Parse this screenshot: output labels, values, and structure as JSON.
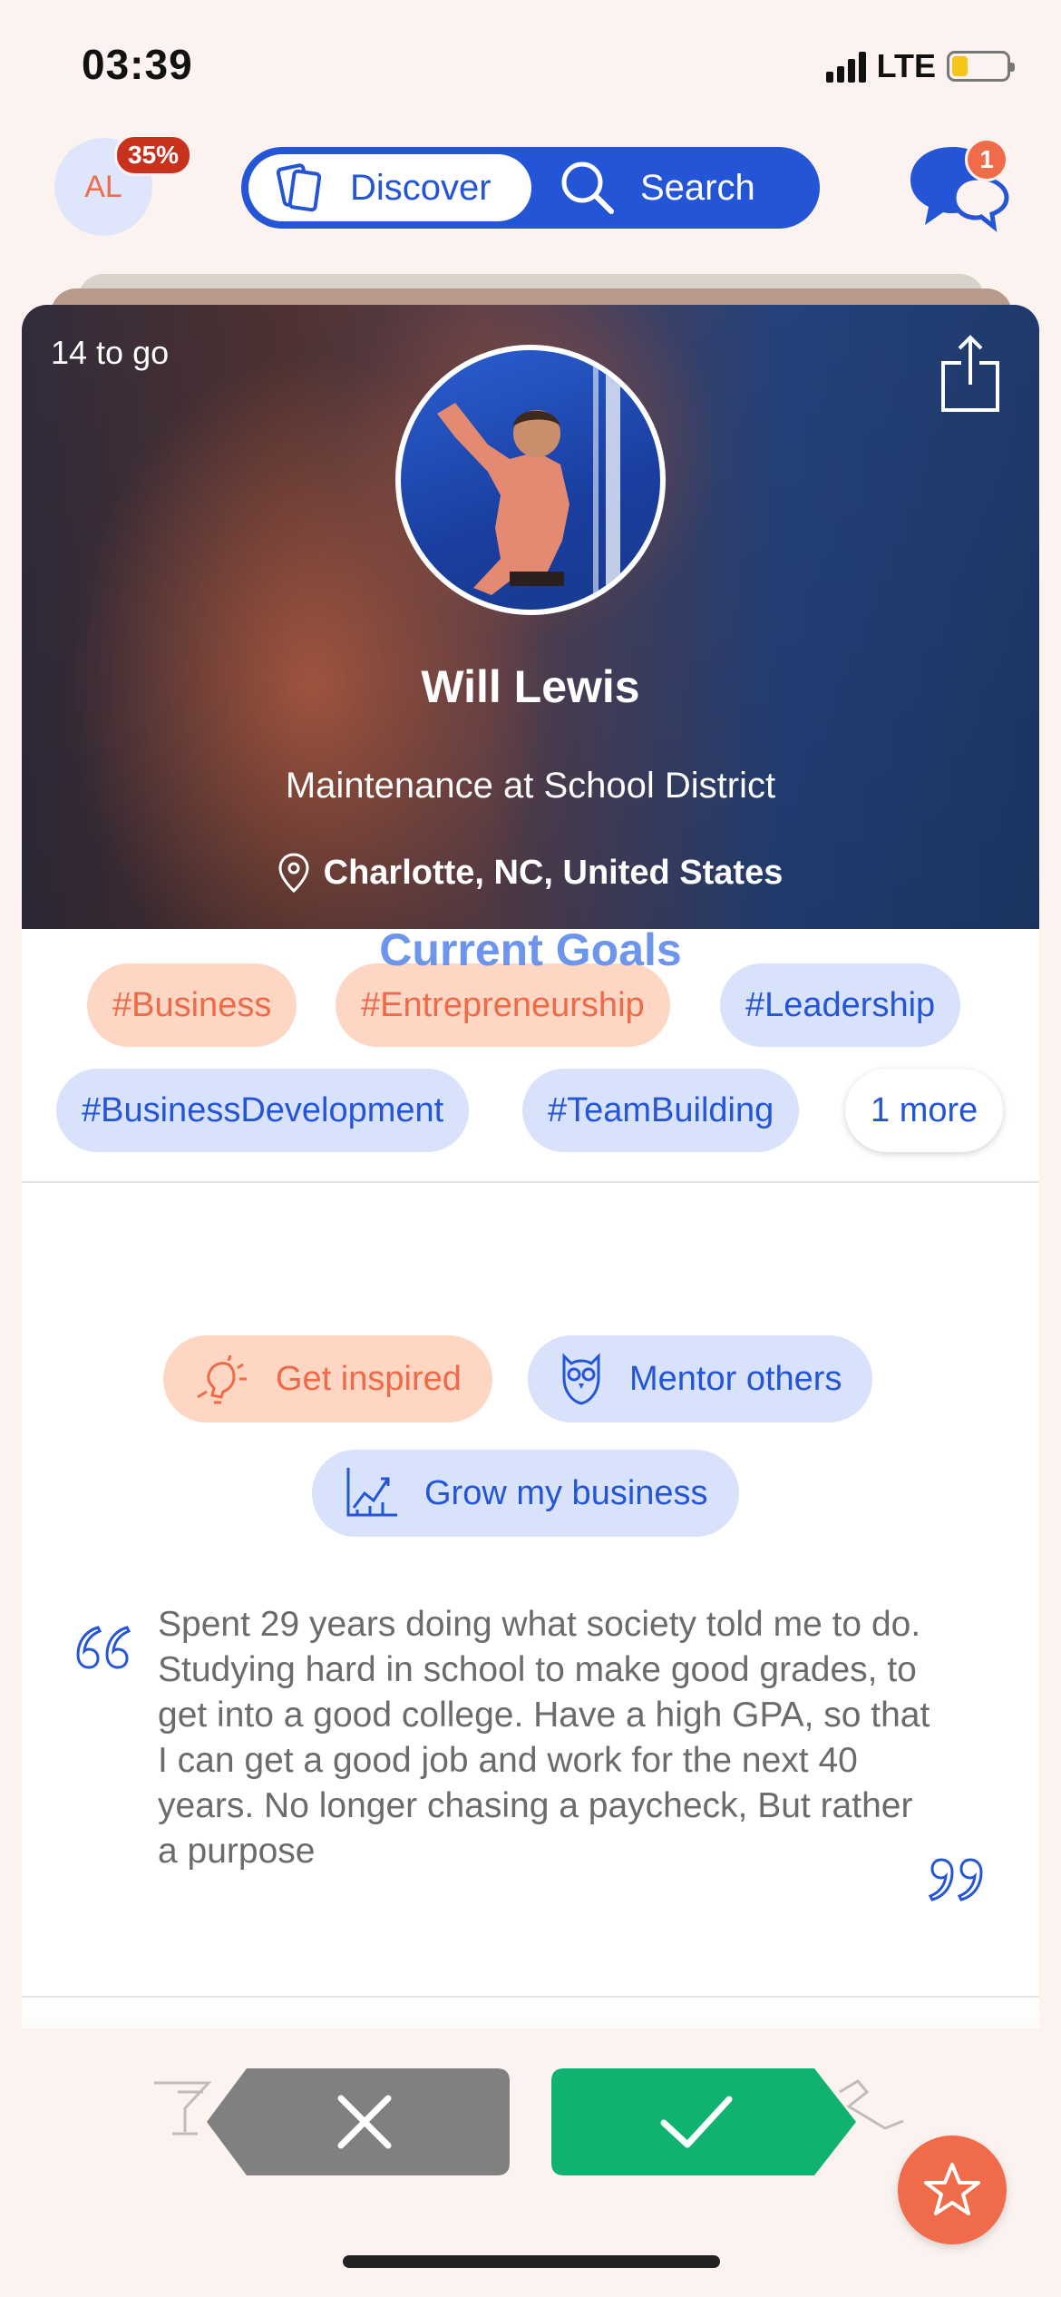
{
  "status_bar": {
    "time": "03:39",
    "network": "LTE",
    "battery_level": 0.3
  },
  "header": {
    "avatar_initials": "AL",
    "profile_progress": "35%",
    "tabs": [
      {
        "label": "Discover",
        "icon": "cards-icon",
        "selected": true
      },
      {
        "label": "Search",
        "icon": "search-icon",
        "selected": false
      }
    ],
    "messages_badge": "1"
  },
  "profile": {
    "remaining": "14 to go",
    "name": "Will Lewis",
    "job": "Maintenance at School District",
    "location": "Charlotte, NC, United States"
  },
  "tags": [
    {
      "label": "#Business",
      "style": "orange"
    },
    {
      "label": "#Entrepreneurship",
      "style": "orange"
    },
    {
      "label": "#Leadership",
      "style": "blue"
    },
    {
      "label": "#BusinessDevelopment",
      "style": "blue"
    },
    {
      "label": "#TeamBuilding",
      "style": "blue"
    }
  ],
  "tags_more": "1 more",
  "goals": {
    "title": "Current Goals",
    "items": [
      {
        "label": "Get inspired",
        "icon": "lightbulb-icon",
        "style": "orange"
      },
      {
        "label": "Mentor others",
        "icon": "owl-icon",
        "style": "blue"
      },
      {
        "label": "Grow my business",
        "icon": "growth-chart-icon",
        "style": "blue"
      }
    ]
  },
  "bio_quote": "Spent 29 years doing what society told me to do. Studying hard in school to make good grades, to get into a good college. Have a high GPA, so that I can get a good job and work for the next 40 years. No longer chasing a paycheck, But rather a purpose",
  "actions": {
    "reject_icon": "close-icon",
    "accept_icon": "check-icon",
    "favorite_icon": "star-icon"
  },
  "colors": {
    "brand_blue": "#2455d6",
    "accent_orange": "#f06b4a",
    "accept_green": "#0fb26f",
    "reject_gray": "#808080",
    "background": "#fcf3f0"
  }
}
